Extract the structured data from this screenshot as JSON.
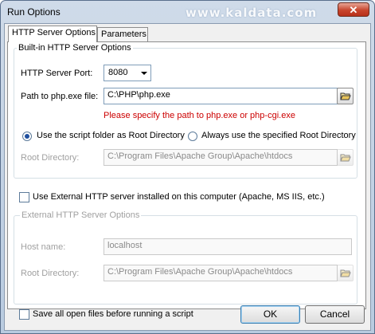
{
  "window": {
    "title": "Run Options",
    "watermark": "www.kaldata.com",
    "close_label": "✕"
  },
  "tabs": [
    {
      "label": "HTTP Server Options"
    },
    {
      "label": "Parameters"
    }
  ],
  "builtin": {
    "group_title": "Built-in HTTP Server Options",
    "port_label": "HTTP Server Port:",
    "port_value": "8080",
    "php_label": "Path to php.exe file:",
    "php_value": "C:\\PHP\\php.exe",
    "php_error": "Please specify the path to php.exe or php-cgi.exe",
    "radio_script_folder": "Use the script folder as Root Directory",
    "radio_specified": "Always use the specified Root Directory",
    "root_label": "Root Directory:",
    "root_value": "C:\\Program Files\\Apache Group\\Apache\\htdocs"
  },
  "use_external_label": "Use External HTTP server installed on this computer (Apache, MS IIS, etc.)",
  "external": {
    "group_title": "External HTTP Server Options",
    "host_label": "Host name:",
    "host_value": "localhost",
    "root_label": "Root Directory:",
    "root_value": "C:\\Program Files\\Apache Group\\Apache\\htdocs"
  },
  "footer": {
    "save_all_label": "Save all open files before running a script",
    "ok_label": "OK",
    "cancel_label": "Cancel"
  },
  "colors": {
    "error_text": "#cc0000",
    "disabled_text": "#a0a0a0",
    "title_bar": "#b9cbe0"
  }
}
